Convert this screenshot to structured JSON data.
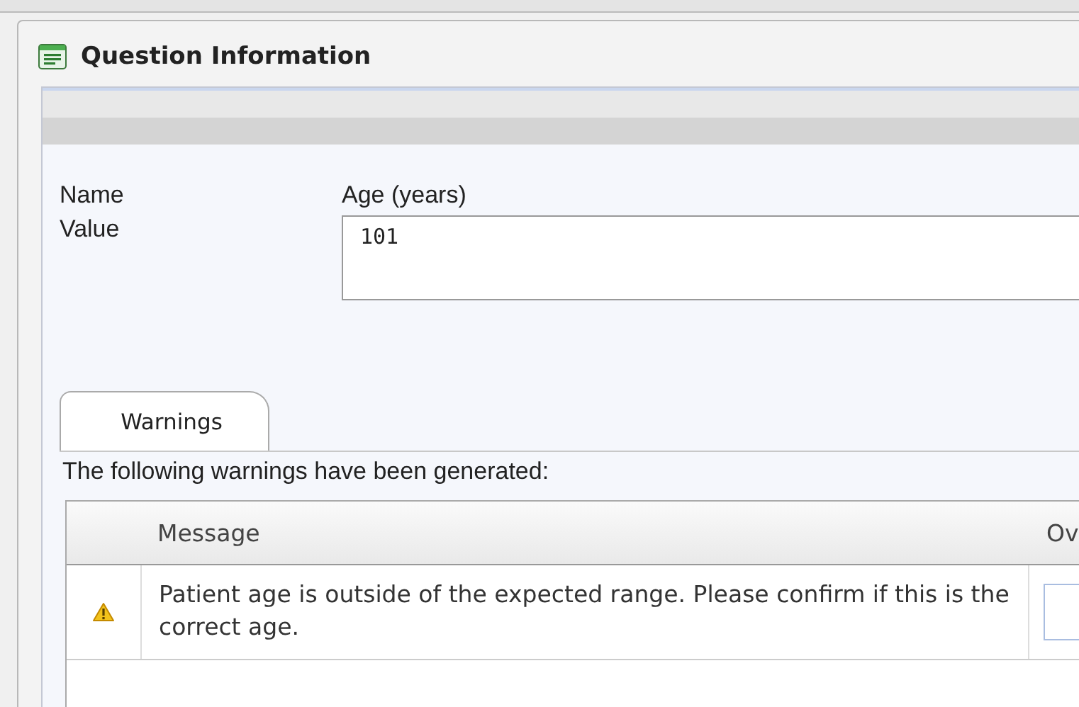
{
  "window": {
    "title": "Question Information"
  },
  "fields": [
    {
      "label": "Name",
      "kind": "text",
      "value": "Age (years)"
    },
    {
      "label": "Value",
      "kind": "input",
      "value": "101"
    }
  ],
  "tabs": [
    {
      "label": "Warnings",
      "selected": true
    }
  ],
  "warnings_intro": "The following warnings have been generated:",
  "table": {
    "columns": [
      "Message",
      "Ov"
    ],
    "rows": [
      {
        "kind": "warning",
        "message": "Patient age is outside of the expected range. Please confirm if this is the correct age."
      }
    ]
  }
}
